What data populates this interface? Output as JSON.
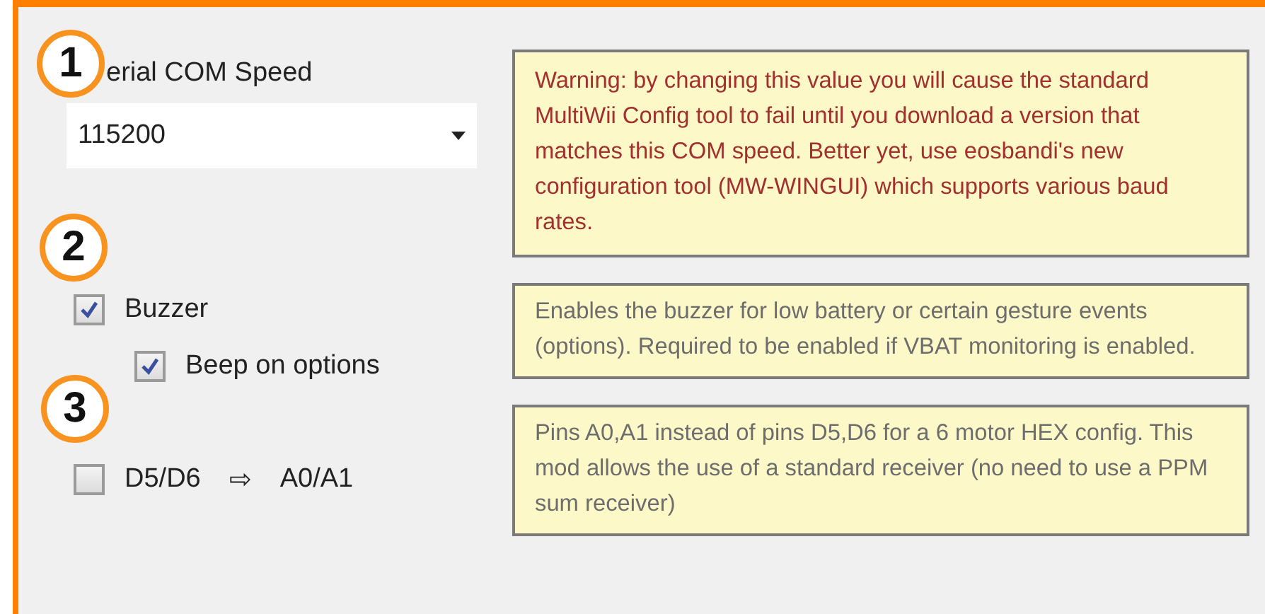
{
  "callouts": [
    "1",
    "2",
    "3"
  ],
  "serial": {
    "label": "erial COM Speed",
    "value": "115200"
  },
  "checks": [
    {
      "label": "Buzzer",
      "checked": true,
      "children": [
        {
          "label": "Beep on options",
          "checked": true
        }
      ]
    },
    {
      "label": "D5/D6",
      "arrow": "⇨",
      "target": "A0/A1",
      "checked": false
    }
  ],
  "notes": [
    {
      "kind": "warning",
      "text": "Warning: by changing this value you will cause the standard MultiWii Config tool to fail until you download a version that matches this COM speed. Better yet, use eosbandi's new configuration tool (MW-WINGUI) which supports various baud rates."
    },
    {
      "kind": "info",
      "text": "Enables the buzzer for low battery or certain gesture events (options). Required to be enabled if VBAT monitoring is enabled."
    },
    {
      "kind": "info",
      "text": "Pins A0,A1 instead of pins D5,D6 for a 6 motor HEX config. This mod allows the use of a standard receiver (no need to use a PPM sum receiver)"
    }
  ]
}
